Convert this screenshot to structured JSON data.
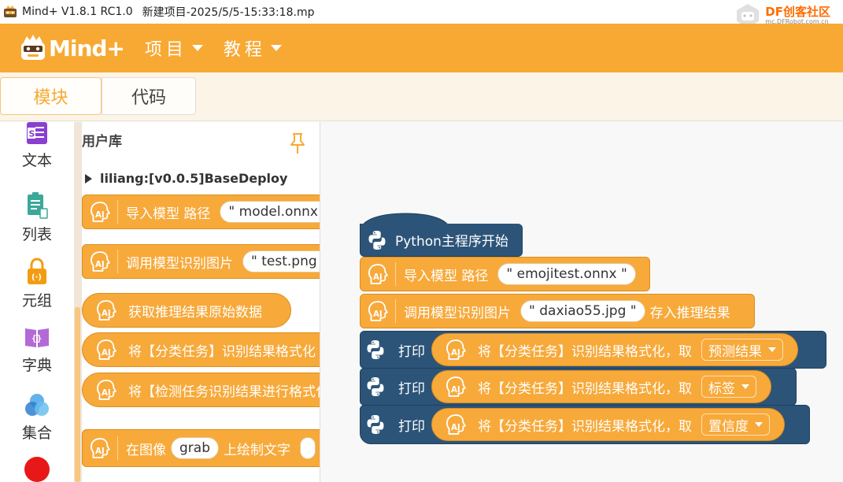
{
  "titlebar": {
    "app": "Mind+ V1.8.1 RC1.0",
    "project": "新建项目-2025/5/5-15:33:18.mp",
    "df_brand": "DF创客社区",
    "df_url": "mc.DFRobot.com.cn"
  },
  "menubar": {
    "brand": "Mind+",
    "items": [
      "项目",
      "教程"
    ]
  },
  "tabs": {
    "blocks": "模块",
    "code": "代码"
  },
  "categories": [
    "文本",
    "列表",
    "元组",
    "字典",
    "集合"
  ],
  "flyout": {
    "title": "用户库",
    "extension": "liliang:[v0.0.5]BaseDeploy",
    "blocks": [
      {
        "text": "导入模型 路径",
        "arg": "model.onnx"
      },
      {
        "text": "调用模型识别图片",
        "arg": "test.png"
      },
      {
        "text": "获取推理结果原始数据"
      },
      {
        "text": "将【分类任务】识别结果格式化"
      },
      {
        "text": "将【检测任务识别结果进行格式化"
      },
      {
        "pre": "在图像",
        "arg": "grab",
        "post": "上绘制文字"
      }
    ]
  },
  "script": {
    "hat": "Python主程序开始",
    "load": {
      "text": "导入模型 路径",
      "arg": "emojitest.onnx"
    },
    "infer": {
      "text": "调用模型识别图片",
      "arg": "daxiao55.jpg",
      "suffix": "存入推理结果"
    },
    "print_label": "打印",
    "format_text": "将【分类任务】识别结果格式化，取",
    "prints": [
      {
        "option": "预测结果"
      },
      {
        "option": "标签"
      },
      {
        "option": "置信度"
      }
    ]
  },
  "colors": {
    "accent": "#f8a933",
    "block": "#f7a93a",
    "python": "#2c5478"
  }
}
